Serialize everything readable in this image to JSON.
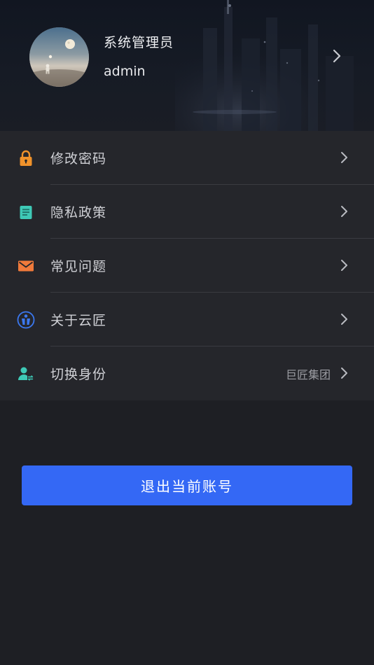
{
  "profile": {
    "display_name": "系统管理员",
    "account": "admin"
  },
  "menu": {
    "items": [
      {
        "label": "修改密码",
        "icon": "lock-icon",
        "color": "#f0922b"
      },
      {
        "label": "隐私政策",
        "icon": "document-icon",
        "color": "#3ec9b6"
      },
      {
        "label": "常见问题",
        "icon": "mail-icon",
        "color": "#f07a3b"
      },
      {
        "label": "关于云匠",
        "icon": "yunjiang-logo-icon",
        "color": "#3b78f0"
      },
      {
        "label": "切换身份",
        "icon": "switch-user-icon",
        "color": "#3ec9b6",
        "value": "巨匠集团"
      }
    ]
  },
  "logout": {
    "label": "退出当前账号",
    "color": "#3468f5"
  }
}
